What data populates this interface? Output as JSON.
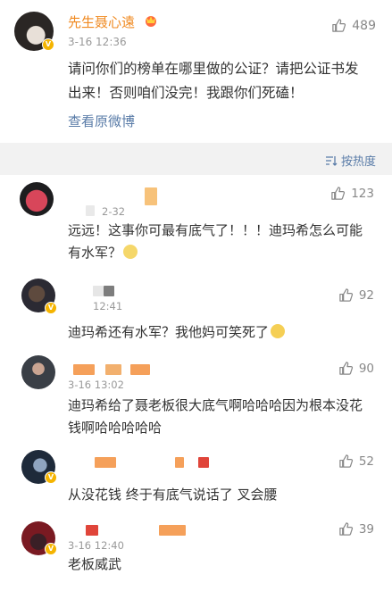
{
  "post": {
    "author": "先生聂心遠",
    "time": "3-16 12:36",
    "likes": "489",
    "text": "请问你们的榜单在哪里做的公证？请把公证书发出来！否则咱们没完！我跟你们死磕！",
    "view_original": "查看原微博"
  },
  "sort": {
    "label": "按热度"
  },
  "comments": [
    {
      "time": "2-32",
      "likes": "123",
      "text": "远远！这事你可最有底气了！！！迪玛希怎么可能有水军？"
    },
    {
      "time": "12:41",
      "likes": "92",
      "text": "迪玛希还有水军？我他妈可笑死了"
    },
    {
      "time": "3-16 13:02",
      "likes": "90",
      "text": "迪玛希给了聂老板很大底气啊哈哈哈因为根本没花钱啊哈哈哈哈哈"
    },
    {
      "time": "",
      "likes": "52",
      "text": "从没花钱 终于有底气说话了 叉会腰"
    },
    {
      "time": "3-16 12:40",
      "likes": "39",
      "text": "老板威武"
    }
  ],
  "colors": {
    "author": "#f08a21",
    "link": "#5a7ca8",
    "muted": "#999999",
    "vip_badge": "#f5b400",
    "blur_orange": "#f5a05a",
    "blur_red": "#e0453a"
  },
  "icons": {
    "like": "thumb-up-icon",
    "sort": "sort-icon",
    "crown": "crown-icon",
    "verified": "verified-badge-icon"
  }
}
